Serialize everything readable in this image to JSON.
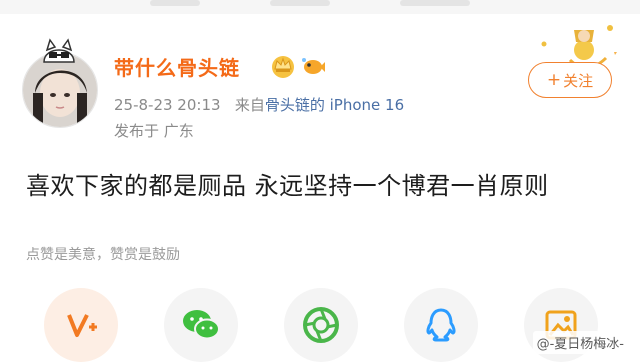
{
  "post": {
    "username": "带什么骨头链",
    "timestamp": "25-8-23 20:13",
    "source_prefix": "来自",
    "source_link": "骨头链的 iPhone 16",
    "location": "发布于 广东",
    "follow_label": "关注",
    "content": "喜欢下家的都是厕品 永远坚持一个博君一肖原则",
    "reward_hint": "点赞是美意，赞赏是鼓励"
  },
  "actions": [
    {
      "name": "vip-reward",
      "icon": "v-plus-icon"
    },
    {
      "name": "wechat",
      "icon": "wechat-icon"
    },
    {
      "name": "moments",
      "icon": "camera-aperture-icon"
    },
    {
      "name": "qq",
      "icon": "qq-icon"
    },
    {
      "name": "save-image",
      "icon": "image-icon"
    }
  ],
  "watermark": "@-夏日杨梅冰-",
  "colors": {
    "username": "#f46a18",
    "follow": "#f1812f",
    "meta": "#8a8a8a",
    "wechat": "#3fbf3f",
    "qq": "#2b9cff",
    "moments": "#4ab64a"
  }
}
